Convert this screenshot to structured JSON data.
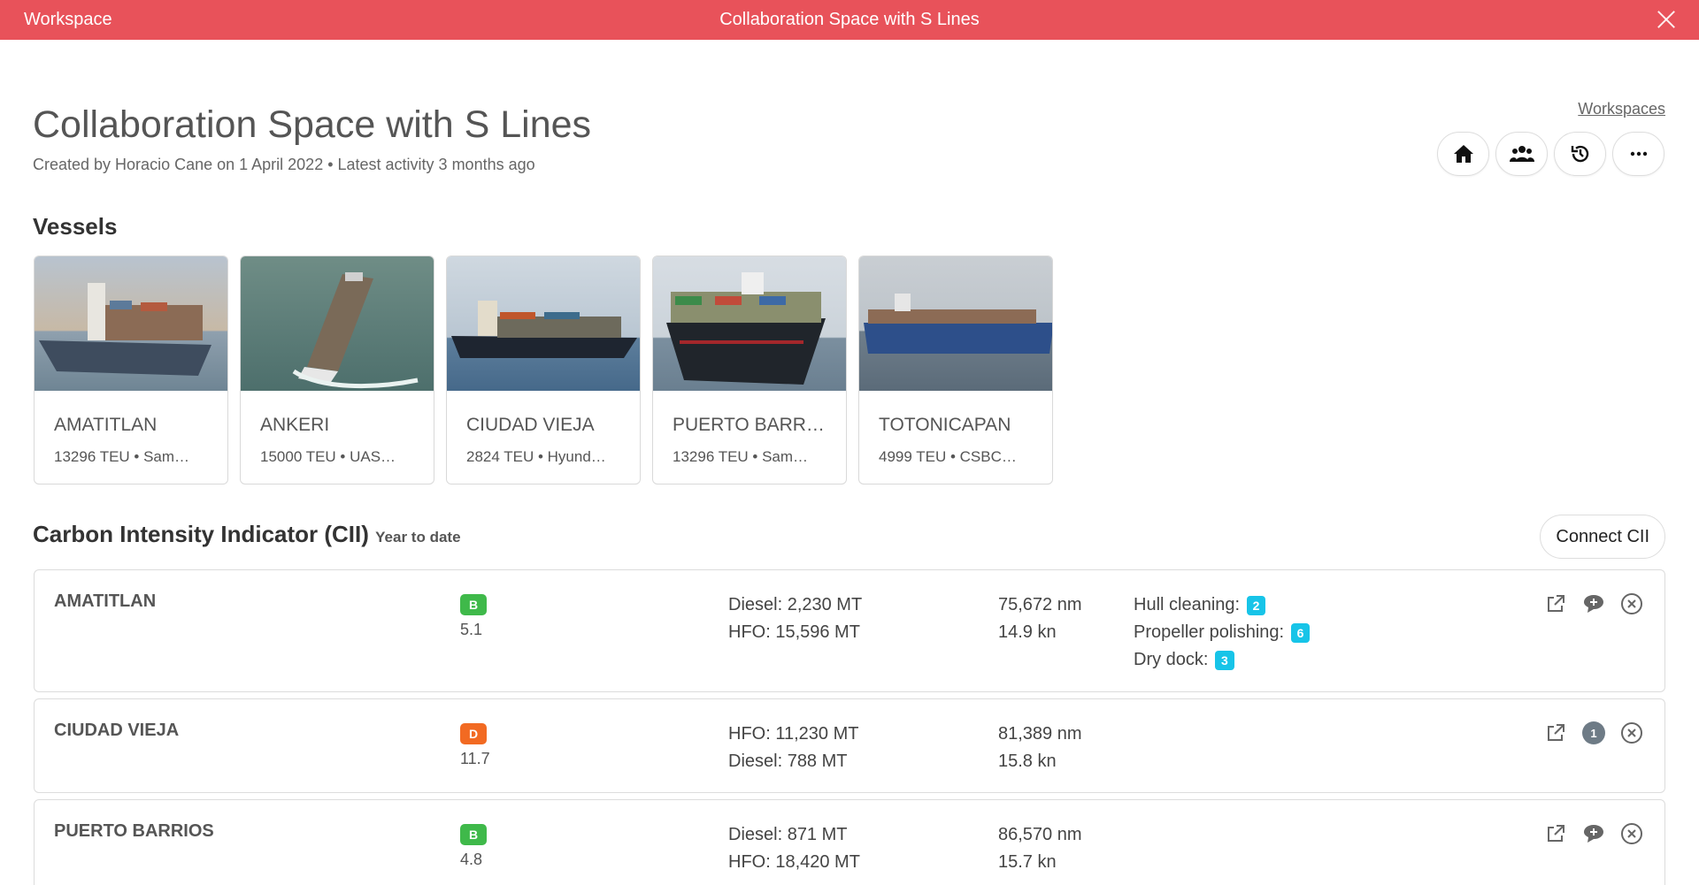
{
  "titlebar": {
    "app": "Workspace",
    "title": "Collaboration Space with S Lines"
  },
  "header": {
    "title": "Collaboration Space with S Lines",
    "subtitle": "Created by Horacio Cane on 1 April 2022 • Latest activity 3 months ago",
    "workspaces_link": "Workspaces",
    "actions": [
      "home-icon",
      "users-icon",
      "history-icon",
      "more-icon"
    ]
  },
  "vessels": {
    "title": "Vessels",
    "items": [
      {
        "name": "AMATITLAN",
        "meta": "13296 TEU • Sam…"
      },
      {
        "name": "ANKERI",
        "meta": "15000 TEU • UAS…"
      },
      {
        "name": "CIUDAD VIEJA",
        "meta": "2824 TEU • Hyund…"
      },
      {
        "name": "PUERTO BARR…",
        "meta": "13296 TEU • Sam…"
      },
      {
        "name": "TOTONICAPAN",
        "meta": "4999 TEU • CSBC…"
      }
    ]
  },
  "cii": {
    "title": "Carbon Intensity Indicator (CII)",
    "subtitle": "Year to date",
    "connect_label": "Connect CII",
    "rows": [
      {
        "name": "AMATITLAN",
        "grade": "B",
        "grade_color": "#3fb94a",
        "score": "5.1",
        "fuel1": "Diesel: 2,230 MT",
        "fuel2": "HFO: 15,596 MT",
        "distance": "75,672 nm",
        "speed": "14.9 kn",
        "tasks": [
          {
            "label": "Hull cleaning:",
            "count": "2"
          },
          {
            "label": "Propeller polishing:",
            "count": "6"
          },
          {
            "label": "Dry dock:",
            "count": "3"
          }
        ],
        "comment_count": ""
      },
      {
        "name": "CIUDAD VIEJA",
        "grade": "D",
        "grade_color": "#f26a22",
        "score": "11.7",
        "fuel1": "HFO: 11,230 MT",
        "fuel2": "Diesel: 788 MT",
        "distance": "81,389 nm",
        "speed": "15.8 kn",
        "tasks": [],
        "comment_count": "1"
      },
      {
        "name": "PUERTO BARRIOS",
        "grade": "B",
        "grade_color": "#3fb94a",
        "score": "4.8",
        "fuel1": "Diesel: 871 MT",
        "fuel2": "HFO: 18,420 MT",
        "distance": "86,570 nm",
        "speed": "15.7 kn",
        "tasks": [],
        "comment_count": ""
      }
    ]
  }
}
